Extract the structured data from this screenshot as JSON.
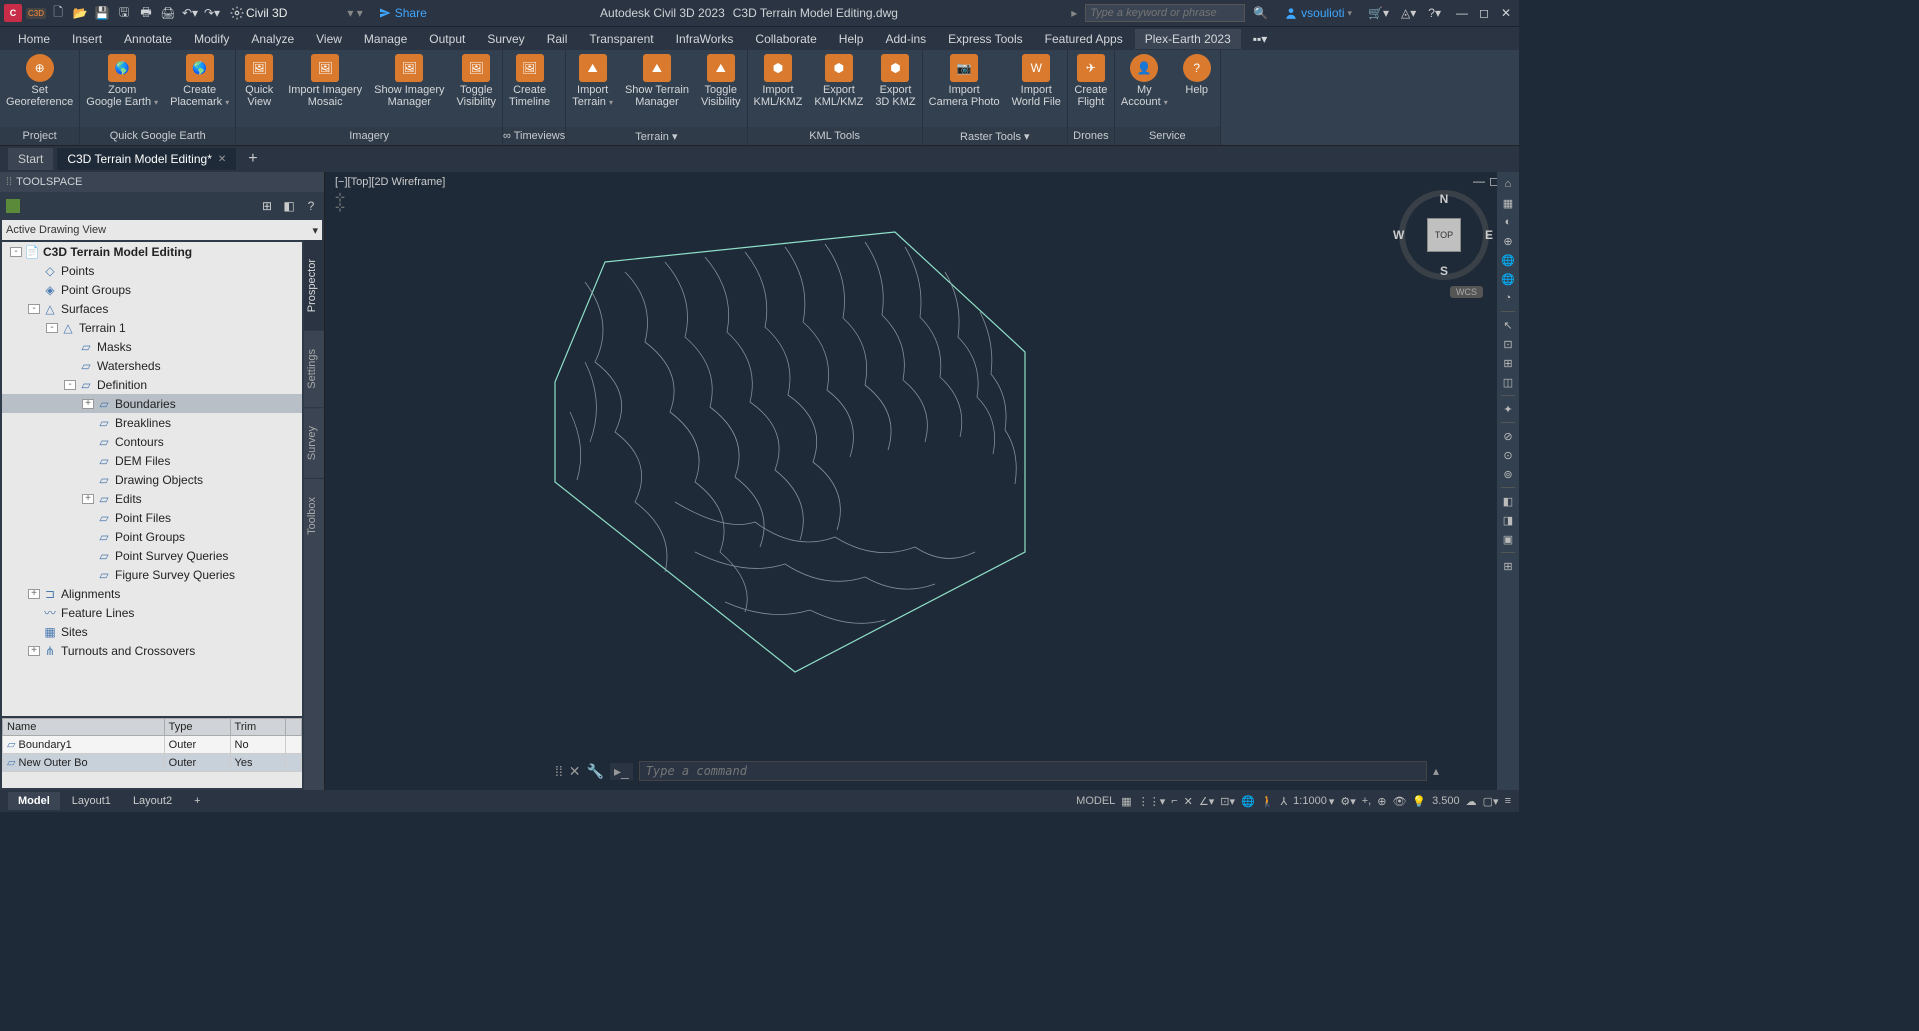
{
  "titlebar": {
    "workspace": "Civil 3D",
    "share": "Share",
    "app_name": "Autodesk Civil 3D 2023",
    "file_name": "C3D Terrain Model Editing.dwg",
    "search_placeholder": "Type a keyword or phrase",
    "user": "vsoulioti"
  },
  "menubar": [
    "Home",
    "Insert",
    "Annotate",
    "Modify",
    "Analyze",
    "View",
    "Manage",
    "Output",
    "Survey",
    "Rail",
    "Transparent",
    "InfraWorks",
    "Collaborate",
    "Help",
    "Add-ins",
    "Express Tools",
    "Featured Apps",
    "Plex-Earth 2023"
  ],
  "menubar_active_index": 17,
  "ribbon": {
    "panels": [
      {
        "title": "Project",
        "buttons": [
          {
            "label": "Set\nGeoreference",
            "icon": "target"
          }
        ]
      },
      {
        "title": "Quick Google Earth",
        "buttons": [
          {
            "label": "Zoom\nGoogle Earth",
            "icon": "globe",
            "caret": true
          },
          {
            "label": "Create\nPlacemark",
            "icon": "globe",
            "caret": true
          }
        ]
      },
      {
        "title": "Imagery",
        "buttons": [
          {
            "label": "Quick\nView",
            "icon": "img"
          },
          {
            "label": "Import Imagery\nMosaic",
            "icon": "img"
          },
          {
            "label": "Show Imagery\nManager",
            "icon": "img"
          },
          {
            "label": "Toggle\nVisibility",
            "icon": "img"
          }
        ]
      },
      {
        "title": "∞ Timeviews",
        "buttons": [
          {
            "label": "Create\nTimeline",
            "icon": "img"
          }
        ]
      },
      {
        "title": "Terrain ▾",
        "buttons": [
          {
            "label": "Import\nTerrain",
            "icon": "terr",
            "caret": true
          },
          {
            "label": "Show Terrain\nManager",
            "icon": "terr"
          },
          {
            "label": "Toggle\nVisibility",
            "icon": "terr"
          }
        ]
      },
      {
        "title": "KML Tools",
        "buttons": [
          {
            "label": "Import\nKML/KMZ",
            "icon": "kml"
          },
          {
            "label": "Export\nKML/KMZ",
            "icon": "kml"
          },
          {
            "label": "Export\n3D KMZ",
            "icon": "kml"
          }
        ]
      },
      {
        "title": "Raster Tools ▾",
        "buttons": [
          {
            "label": "Import\nCamera Photo",
            "icon": "cam"
          },
          {
            "label": "Import\nWorld File",
            "icon": "world"
          }
        ]
      },
      {
        "title": "Drones",
        "buttons": [
          {
            "label": "Create\nFlight",
            "icon": "drone"
          }
        ]
      },
      {
        "title": "Service",
        "buttons": [
          {
            "label": "My\nAccount",
            "icon": "user",
            "caret": true
          },
          {
            "label": "Help",
            "icon": "help"
          }
        ]
      }
    ]
  },
  "filetabs": {
    "tabs": [
      {
        "label": "Start",
        "active": false
      },
      {
        "label": "C3D Terrain Model Editing*",
        "active": true,
        "closable": true
      }
    ]
  },
  "toolspace": {
    "title": "TOOLSPACE",
    "dropdown": "Active Drawing View",
    "vtabs": [
      "Prospector",
      "Settings",
      "Survey",
      "Toolbox"
    ],
    "vtab_active": 0,
    "tree": [
      {
        "indent": 0,
        "exp": "-",
        "icon": "📄",
        "label": "C3D Terrain Model Editing",
        "bold": true
      },
      {
        "indent": 1,
        "exp": " ",
        "icon": "◇",
        "label": "Points"
      },
      {
        "indent": 1,
        "exp": " ",
        "icon": "◈",
        "label": "Point Groups"
      },
      {
        "indent": 1,
        "exp": "-",
        "icon": "△",
        "label": "Surfaces"
      },
      {
        "indent": 2,
        "exp": "-",
        "icon": "△",
        "label": "Terrain 1",
        "corner": true
      },
      {
        "indent": 3,
        "exp": " ",
        "icon": "▱",
        "label": "Masks"
      },
      {
        "indent": 3,
        "exp": " ",
        "icon": "▱",
        "label": "Watersheds"
      },
      {
        "indent": 3,
        "exp": "-",
        "icon": "▱",
        "label": "Definition"
      },
      {
        "indent": 4,
        "exp": "+",
        "icon": "▱",
        "label": "Boundaries",
        "selected": true
      },
      {
        "indent": 4,
        "exp": " ",
        "icon": "▱",
        "label": "Breaklines"
      },
      {
        "indent": 4,
        "exp": " ",
        "icon": "▱",
        "label": "Contours"
      },
      {
        "indent": 4,
        "exp": " ",
        "icon": "▱",
        "label": "DEM Files"
      },
      {
        "indent": 4,
        "exp": " ",
        "icon": "▱",
        "label": "Drawing Objects"
      },
      {
        "indent": 4,
        "exp": "+",
        "icon": "▱",
        "label": "Edits"
      },
      {
        "indent": 4,
        "exp": " ",
        "icon": "▱",
        "label": "Point Files"
      },
      {
        "indent": 4,
        "exp": " ",
        "icon": "▱",
        "label": "Point Groups"
      },
      {
        "indent": 4,
        "exp": " ",
        "icon": "▱",
        "label": "Point Survey Queries"
      },
      {
        "indent": 4,
        "exp": " ",
        "icon": "▱",
        "label": "Figure Survey Queries"
      },
      {
        "indent": 1,
        "exp": "+",
        "icon": "⊐",
        "label": "Alignments"
      },
      {
        "indent": 1,
        "exp": " ",
        "icon": "〰",
        "label": "Feature Lines"
      },
      {
        "indent": 1,
        "exp": " ",
        "icon": "▦",
        "label": "Sites"
      },
      {
        "indent": 1,
        "exp": "+",
        "icon": "⋔",
        "label": "Turnouts and Crossovers"
      }
    ],
    "grid": {
      "headers": [
        "Name",
        "Type",
        "Trim",
        ""
      ],
      "rows": [
        {
          "cells": [
            "Boundary1",
            "Outer",
            "No",
            ""
          ],
          "sel": false
        },
        {
          "cells": [
            "New Outer Bo",
            "Outer",
            "Yes",
            ""
          ],
          "sel": true
        }
      ]
    }
  },
  "viewport": {
    "label": "[−][Top][2D Wireframe]",
    "cube": "TOP",
    "wcs": "WCS",
    "cmd_placeholder": "Type a command"
  },
  "bottomtabs": {
    "tabs": [
      {
        "label": "Model",
        "active": true
      },
      {
        "label": "Layout1"
      },
      {
        "label": "Layout2"
      }
    ],
    "status": {
      "model": "MODEL",
      "scale": "1:1000",
      "value": "3.500"
    }
  }
}
